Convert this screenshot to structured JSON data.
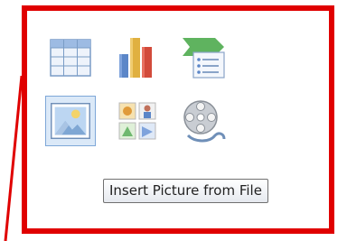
{
  "placeholder_icons": {
    "row1": [
      "table-icon",
      "chart-icon",
      "smartart-icon"
    ],
    "row2": [
      "picture-icon",
      "clipart-icon",
      "media-clip-icon"
    ]
  },
  "tooltip": {
    "text": "Insert Picture from File"
  },
  "colors": {
    "highlight_border": "#e00000",
    "tooltip_border": "#707070",
    "selected_icon_bg": "#dbe9f8"
  }
}
